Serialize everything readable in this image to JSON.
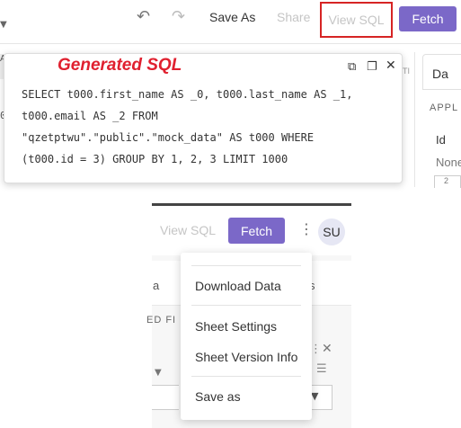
{
  "toolbar": {
    "save_as_label": "Save As",
    "share_label": "Share",
    "view_sql_label": "View SQL",
    "fetch_label": "Fetch"
  },
  "background_panel": {
    "tab_label": "Da",
    "section_label": "APPL",
    "field_label": "Id",
    "field_value": "None",
    "ti_text": "TI",
    "left_tab_text": "A",
    "left_row_text": "0",
    "small_box_text": "2"
  },
  "sql_popup": {
    "title": "Generated SQL",
    "code_lines": [
      "SELECT t000.first_name AS _0, t000.last_name AS _1,",
      "t000.email AS _2 FROM",
      "\"qzetptwu\".\"public\".\"mock_data\" AS t000 WHERE",
      "(t000.id = 3) GROUP BY 1, 2, 3 LIMIT 1000"
    ]
  },
  "bottom_toolbar": {
    "view_sql_label": "View SQL",
    "fetch_label": "Fetch",
    "user_initials": "SU"
  },
  "bottom_background": {
    "tab_a": "a",
    "tab_s": "s",
    "section_label": "ED FI"
  },
  "menu": {
    "items": [
      {
        "label": "Download Data"
      },
      {
        "label": "Sheet Settings"
      },
      {
        "label": "Sheet Version Info"
      },
      {
        "label": "Save as"
      }
    ]
  },
  "colors": {
    "accent": "#7b68c8",
    "highlight_border": "#d62424",
    "annotation_text": "#e0202f",
    "disabled_text": "#c5c5c5"
  },
  "icons": [
    "chevron-down-icon",
    "undo-icon",
    "redo-icon",
    "external-link-icon",
    "copy-icon",
    "close-icon",
    "kebab-menu-icon",
    "list-icon"
  ]
}
